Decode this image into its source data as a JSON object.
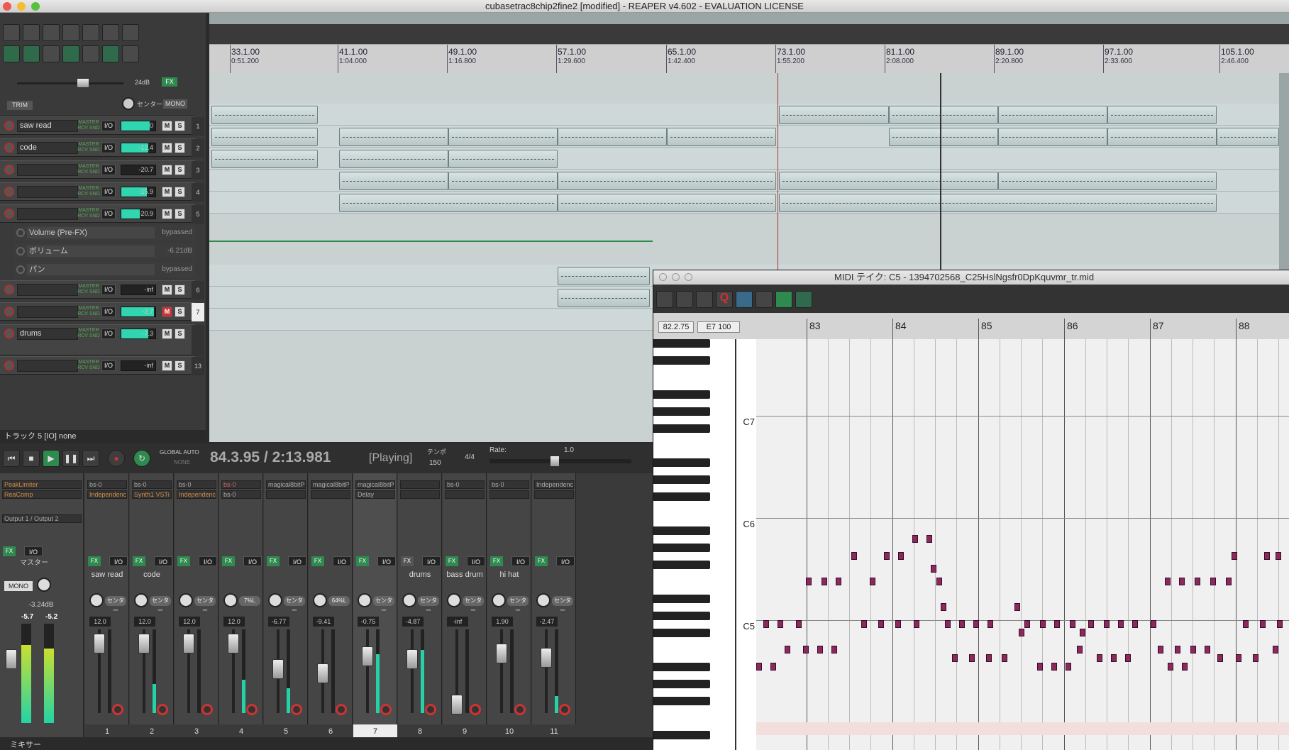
{
  "window_title": "cubasetrac8chip2fine2 [modified] - REAPER v4.602 - EVALUATION LICENSE",
  "master": {
    "volume_db": "24dB",
    "fx": "FX",
    "trim": "TRIM",
    "mono": "MONO",
    "center": "センター"
  },
  "tracks": [
    {
      "num": "1",
      "name": "saw read",
      "vol": "0"
    },
    {
      "num": "2",
      "name": "code",
      "vol": "-12.4"
    },
    {
      "num": "3",
      "name": "",
      "vol": "-20.7"
    },
    {
      "num": "4",
      "name": "",
      "vol": "-15.9"
    },
    {
      "num": "5",
      "name": "",
      "vol": "-20.9"
    },
    {
      "num": "6",
      "name": "",
      "vol": "-inf"
    },
    {
      "num": "7",
      "name": "",
      "vol": "-2.7"
    },
    {
      "num": "8",
      "name": "drums",
      "vol": "-7.3"
    },
    {
      "num": "13",
      "name": "",
      "vol": "-inf"
    }
  ],
  "envelopes": [
    {
      "name": "Volume (Pre-FX)",
      "value": "bypassed"
    },
    {
      "name": "ボリューム",
      "value": "-6.21dB"
    },
    {
      "name": "パン",
      "value": "bypassed"
    }
  ],
  "track_status": "トラック 5 [IO] none",
  "ruler": [
    {
      "bar": "33.1.00",
      "time": "0:51.200"
    },
    {
      "bar": "41.1.00",
      "time": "1:04.000"
    },
    {
      "bar": "49.1.00",
      "time": "1:16.800"
    },
    {
      "bar": "57.1.00",
      "time": "1:29.600"
    },
    {
      "bar": "65.1.00",
      "time": "1:42.400"
    },
    {
      "bar": "73.1.00",
      "time": "1:55.200"
    },
    {
      "bar": "81.1.00",
      "time": "2:08.000"
    },
    {
      "bar": "89.1.00",
      "time": "2:20.800"
    },
    {
      "bar": "97.1.00",
      "time": "2:33.600"
    },
    {
      "bar": "105.1.00",
      "time": "2:46.400"
    }
  ],
  "transport": {
    "position": "84.3.95 / 2:13.981",
    "state": "[Playing]",
    "tempo_label": "テンポ",
    "tempo": "150",
    "timesig": "4/4",
    "rate_label": "Rate:",
    "rate": "1.0",
    "global_auto": "GLOBAL AUTO",
    "none": "NONE"
  },
  "mixer": {
    "master": {
      "fx1": "PeakLimiter",
      "fx2": "ReaComp",
      "output": "Output 1 / Output 2",
      "label": "マスター",
      "vol": "-3.24dB",
      "peak_l": "-5.7",
      "peak_r": "-5.2",
      "mono": "MONO"
    },
    "strips": [
      {
        "num": "1",
        "name": "saw read",
        "fx1": "bs-0",
        "fx2": "Independence",
        "vol": "12.0",
        "pan": "センター",
        "meter": 0.0
      },
      {
        "num": "2",
        "name": "code",
        "fx1": "bs-0",
        "fx2": "Synth1 VSTi",
        "vol": "12.0",
        "pan": "センター",
        "meter": 0.35
      },
      {
        "num": "3",
        "name": "",
        "fx1": "bs-0",
        "fx2": "Independence",
        "vol": "12.0",
        "pan": "センター",
        "meter": 0.0
      },
      {
        "num": "4",
        "name": "",
        "fx1": "bs-0",
        "fx2": "bs-0",
        "vol": "12.0",
        "pan": "7%L",
        "meter": 0.4
      },
      {
        "num": "5",
        "name": "",
        "fx1": "magical8bitPlu",
        "fx2": "",
        "vol": "-6.77",
        "pan": "センター",
        "meter": 0.3
      },
      {
        "num": "6",
        "name": "",
        "fx1": "magical8bitPlu",
        "fx2": "",
        "vol": "-9.41",
        "pan": "64%L",
        "meter": 0.0
      },
      {
        "num": "7",
        "name": "",
        "fx1": "magical8bitPlu",
        "fx2": "Delay",
        "vol": "-0.75",
        "pan": "センター",
        "meter": 0.7
      },
      {
        "num": "8",
        "name": "drums",
        "fx1": "",
        "fx2": "",
        "vol": "-4.87",
        "pan": "センター",
        "meter": 0.75
      },
      {
        "num": "9",
        "name": "bass drum",
        "fx1": "bs-0",
        "fx2": "",
        "vol": "-inf",
        "pan": "センター",
        "meter": 0.0
      },
      {
        "num": "10",
        "name": "hi hat",
        "fx1": "bs-0",
        "fx2": "",
        "vol": "1.90",
        "pan": "センター",
        "meter": 0.0
      },
      {
        "num": "11",
        "name": "",
        "fx1": "Independence",
        "fx2": "",
        "vol": "-2.47",
        "pan": "センター",
        "meter": 0.2
      }
    ],
    "tab_label": "ミキサー"
  },
  "midi_editor": {
    "title": "MIDI テイク: C5 - 1394702568_C25HslNgsfr0DpKquvmr_tr.mid",
    "position": "82.2.75",
    "note_info": "E7 100",
    "bars": [
      "83",
      "84",
      "85",
      "86",
      "87",
      "88"
    ],
    "key_labels": [
      "C7",
      "C6",
      "C5"
    ]
  }
}
